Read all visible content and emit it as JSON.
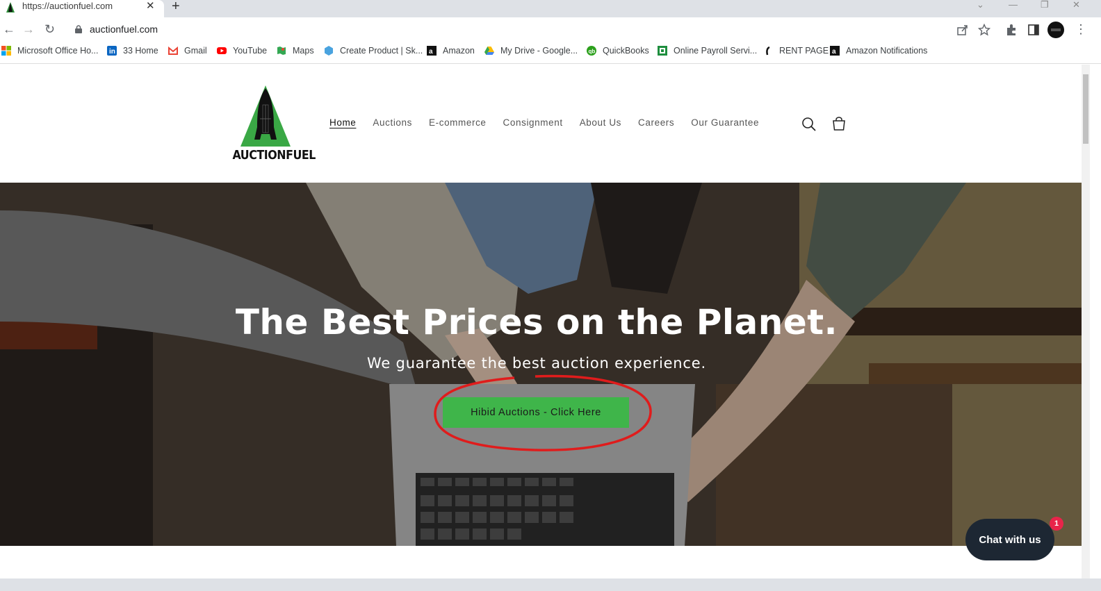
{
  "browser": {
    "tab_title": "https://auctionfuel.com",
    "tab_close": "✕",
    "new_tab": "+",
    "url": "auctionfuel.com",
    "bookmarks": [
      {
        "label": "Microsoft Office Ho...",
        "icon": "microsoft-icon"
      },
      {
        "label": "33 Home",
        "icon": "linkedin-icon"
      },
      {
        "label": "Gmail",
        "icon": "gmail-icon"
      },
      {
        "label": "YouTube",
        "icon": "youtube-icon"
      },
      {
        "label": "Maps",
        "icon": "maps-icon"
      },
      {
        "label": "Create Product | Sk...",
        "icon": "product-icon"
      },
      {
        "label": "Amazon",
        "icon": "amazon-icon"
      },
      {
        "label": "My Drive - Google...",
        "icon": "drive-icon"
      },
      {
        "label": "QuickBooks",
        "icon": "quickbooks-icon"
      },
      {
        "label": "Online Payroll Servi...",
        "icon": "payroll-icon"
      },
      {
        "label": "RENT PAGE",
        "icon": "rent-icon"
      },
      {
        "label": "Amazon Notifications",
        "icon": "amazon-icon"
      }
    ]
  },
  "site": {
    "logo_text": "AUCTIONFUEL",
    "nav": [
      "Home",
      "Auctions",
      "E-commerce",
      "Consignment",
      "About Us",
      "Careers",
      "Our Guarantee"
    ],
    "active_nav": "Home",
    "hero": {
      "title": "The Best Prices on the Planet.",
      "subtitle": "We guarantee the best auction experience.",
      "cta_label": "Hibid Auctions - Click Here"
    },
    "chat": {
      "label": "Chat with us",
      "badge_count": "1"
    }
  },
  "colors": {
    "cta_green": "#3fb54a",
    "annotation_red": "#e01c1c",
    "chat_bg": "#1d2733",
    "badge_red": "#e8244a"
  }
}
